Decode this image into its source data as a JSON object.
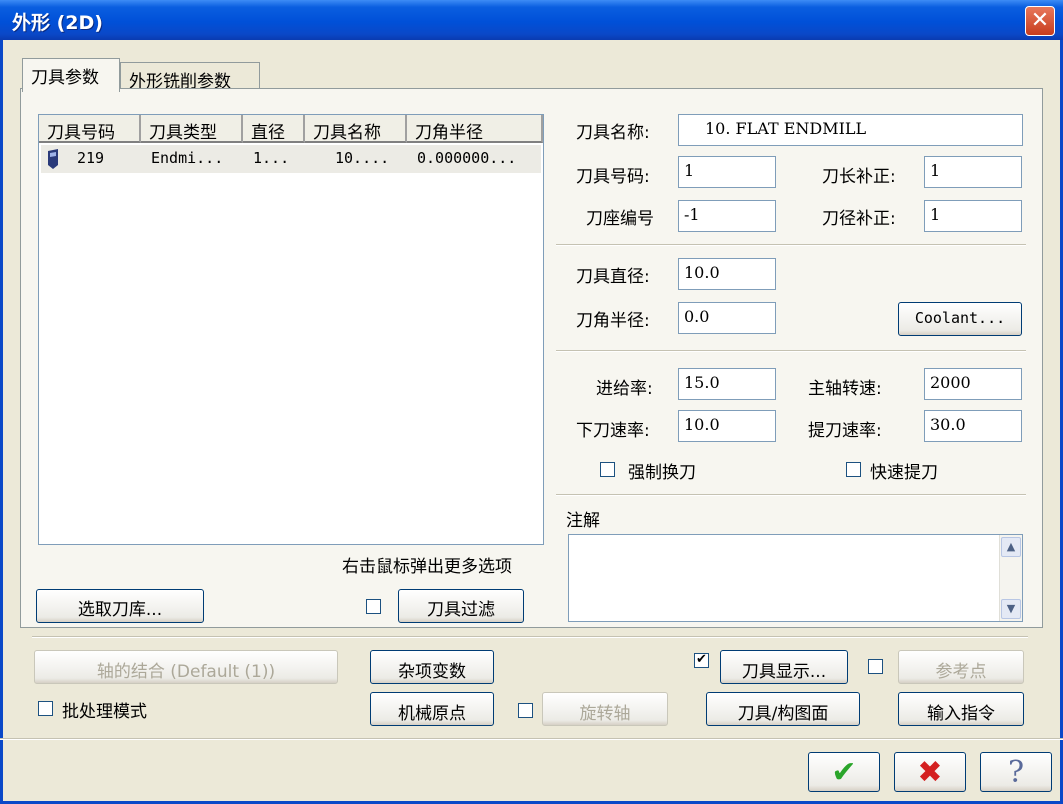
{
  "window": {
    "title": "外形 (2D)",
    "close_glyph": "✕"
  },
  "tabs": [
    {
      "label": "刀具参数"
    },
    {
      "label": "外形铣削参数"
    }
  ],
  "tool_list": {
    "columns": [
      "刀具号码",
      "刀具类型",
      "直径",
      "刀具名称",
      "刀角半径"
    ],
    "rows": [
      {
        "number": "219",
        "type": "Endmi...",
        "diameter": "1...",
        "name": "10....",
        "corner": "0.000000..."
      }
    ],
    "hint": "右击鼠标弹出更多选项"
  },
  "buttons": {
    "select_library": "选取刀库...",
    "tool_filter": "刀具过滤",
    "coolant": "Coolant...",
    "axis_combo": "轴的结合 (Default (1))",
    "misc_values": "杂项变数",
    "machine_origin": "机械原点",
    "rotary_axis": "旋转轴",
    "tool_display": "刀具显示...",
    "tool_plane": "刀具/构图面",
    "ref_point": "参考点",
    "input_cmd": "输入指令",
    "ok_glyph": "✔",
    "cancel_glyph": "✖",
    "help_glyph": "?"
  },
  "fields": {
    "tool_name_label": "刀具名称:",
    "tool_name": "10. FLAT ENDMILL",
    "tool_number_label": "刀具号码:",
    "tool_number": "1",
    "length_offset_label": "刀长补正:",
    "length_offset": "1",
    "holder_label": "刀座编号",
    "holder": "-1",
    "dia_offset_label": "刀径补正:",
    "dia_offset": "1",
    "diameter_label": "刀具直径:",
    "diameter": "10.0",
    "corner_label": "刀角半径:",
    "corner": "0.0",
    "feed_label": "进给率:",
    "feed": "15.0",
    "spindle_label": "主轴转速:",
    "spindle": "2000",
    "plunge_label": "下刀速率:",
    "plunge": "10.0",
    "retract_label": "提刀速率:",
    "retract": "30.0",
    "force_change": "强制换刀",
    "rapid_retract": "快速提刀",
    "comment_label": "注解",
    "batch_mode": "批处理模式"
  },
  "checkbox_marks": {
    "tool_display": "✔"
  },
  "colors": {
    "title_bar": "#0050d8",
    "close": "#c73d1e",
    "ok": "#2aa52a",
    "cancel": "#d42020"
  }
}
